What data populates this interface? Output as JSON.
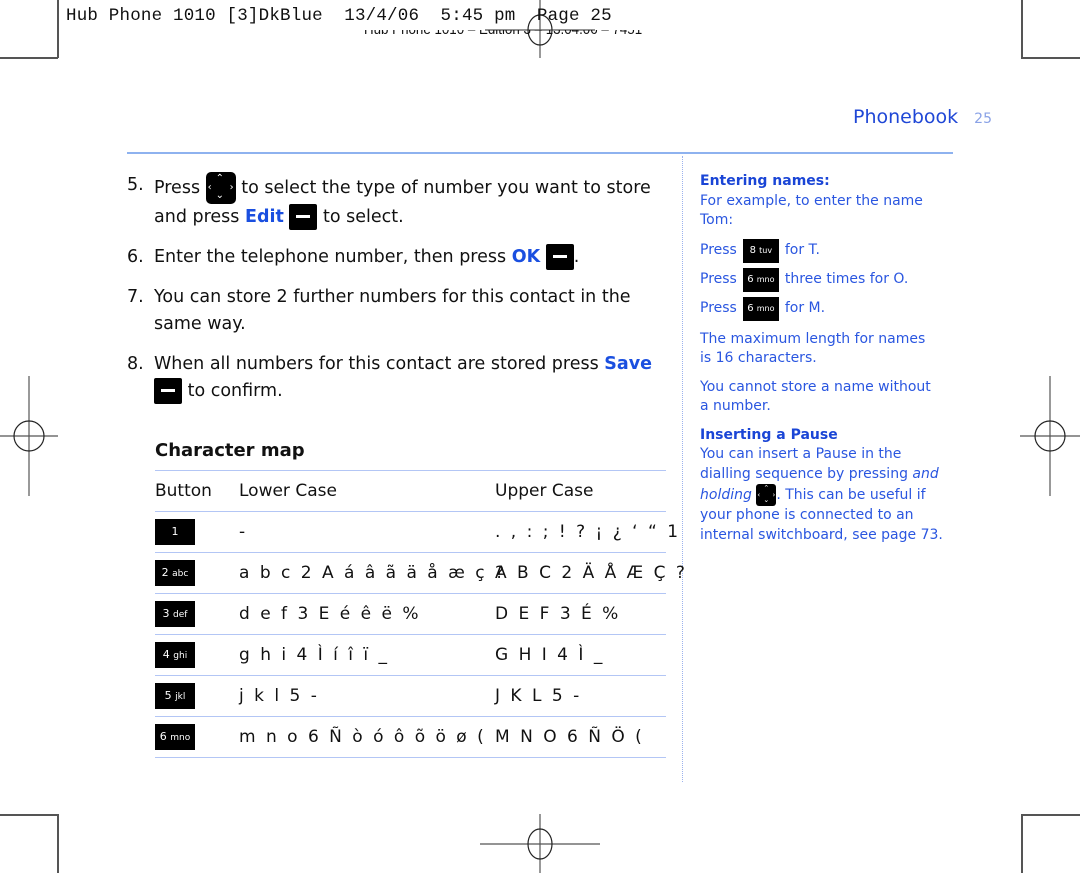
{
  "slug": {
    "line1": "Hub Phone 1010 [3]DkBlue  13/4/06  5:45 pm  Page 25",
    "line2": "Hub Phone 1010 – Edition 3 – 13.04.06 – 7451"
  },
  "header": {
    "section_title": "Phonebook",
    "page_number": "25"
  },
  "steps": [
    {
      "num": "5.",
      "before": "Press",
      "icon": "nav-key-icon",
      "mid": "to select the type of number you want to store and press",
      "keyword": "Edit",
      "key_icon": "softkey-icon",
      "after": "to select."
    },
    {
      "num": "6.",
      "before": "Enter the telephone number, then press",
      "keyword": "OK",
      "key_icon": "softkey-icon",
      "after": "."
    },
    {
      "num": "7.",
      "text": "You can store 2 further numbers for this contact in the same way."
    },
    {
      "num": "8.",
      "before": "When all numbers for this contact are stored press",
      "keyword": "Save",
      "key_icon": "softkey-icon",
      "after": "to confirm."
    }
  ],
  "character_map": {
    "title": "Character map",
    "headers": [
      "Button",
      "Lower Case",
      "Upper Case"
    ],
    "rows": [
      {
        "key_num": "1",
        "key_letters": "",
        "lower": "-",
        "upper": ". , : ; ! ? ¡ ¿ ‘ “ 1"
      },
      {
        "key_num": "2",
        "key_letters": "abc",
        "lower": "a b c 2 A á â ã ä å æ ç ?",
        "upper": "A B C 2 Ä Å Æ Ç ?"
      },
      {
        "key_num": "3",
        "key_letters": "def",
        "lower": "d e f 3 E é ê ë %",
        "upper": "D E F 3 É %"
      },
      {
        "key_num": "4",
        "key_letters": "ghi",
        "lower": "g h i 4 Ì í î ï _",
        "upper": "G H I 4 Ì _"
      },
      {
        "key_num": "5",
        "key_letters": "jkl",
        "lower": "j k l 5 -",
        "upper": "J K L 5 -"
      },
      {
        "key_num": "6",
        "key_letters": "mno",
        "lower": "m n o 6 Ñ ò ó ô õ ö ø (",
        "upper": "M N O 6 Ñ Ö ("
      }
    ]
  },
  "sidebar": {
    "entering_title": "Entering names:",
    "entering_intro": "For example, to enter the name Tom:",
    "press_lines": [
      {
        "press": "Press",
        "key_num": "8",
        "key_letters": "tuv",
        "text": "for T."
      },
      {
        "press": "Press",
        "key_num": "6",
        "key_letters": "mno",
        "text": "three times for O."
      },
      {
        "press": "Press",
        "key_num": "6",
        "key_letters": "mno",
        "text": "for M."
      }
    ],
    "max_length": "The maximum length for names is 16 characters.",
    "no_number": "You cannot store a name without a number.",
    "pause_title": "Inserting a Pause",
    "pause_text_1": "You can insert a Pause in the dialling sequence by pressing",
    "pause_italic": "and holding",
    "pause_text_2": ". This can be useful if your phone is connected to an internal switchboard, see page 73."
  }
}
